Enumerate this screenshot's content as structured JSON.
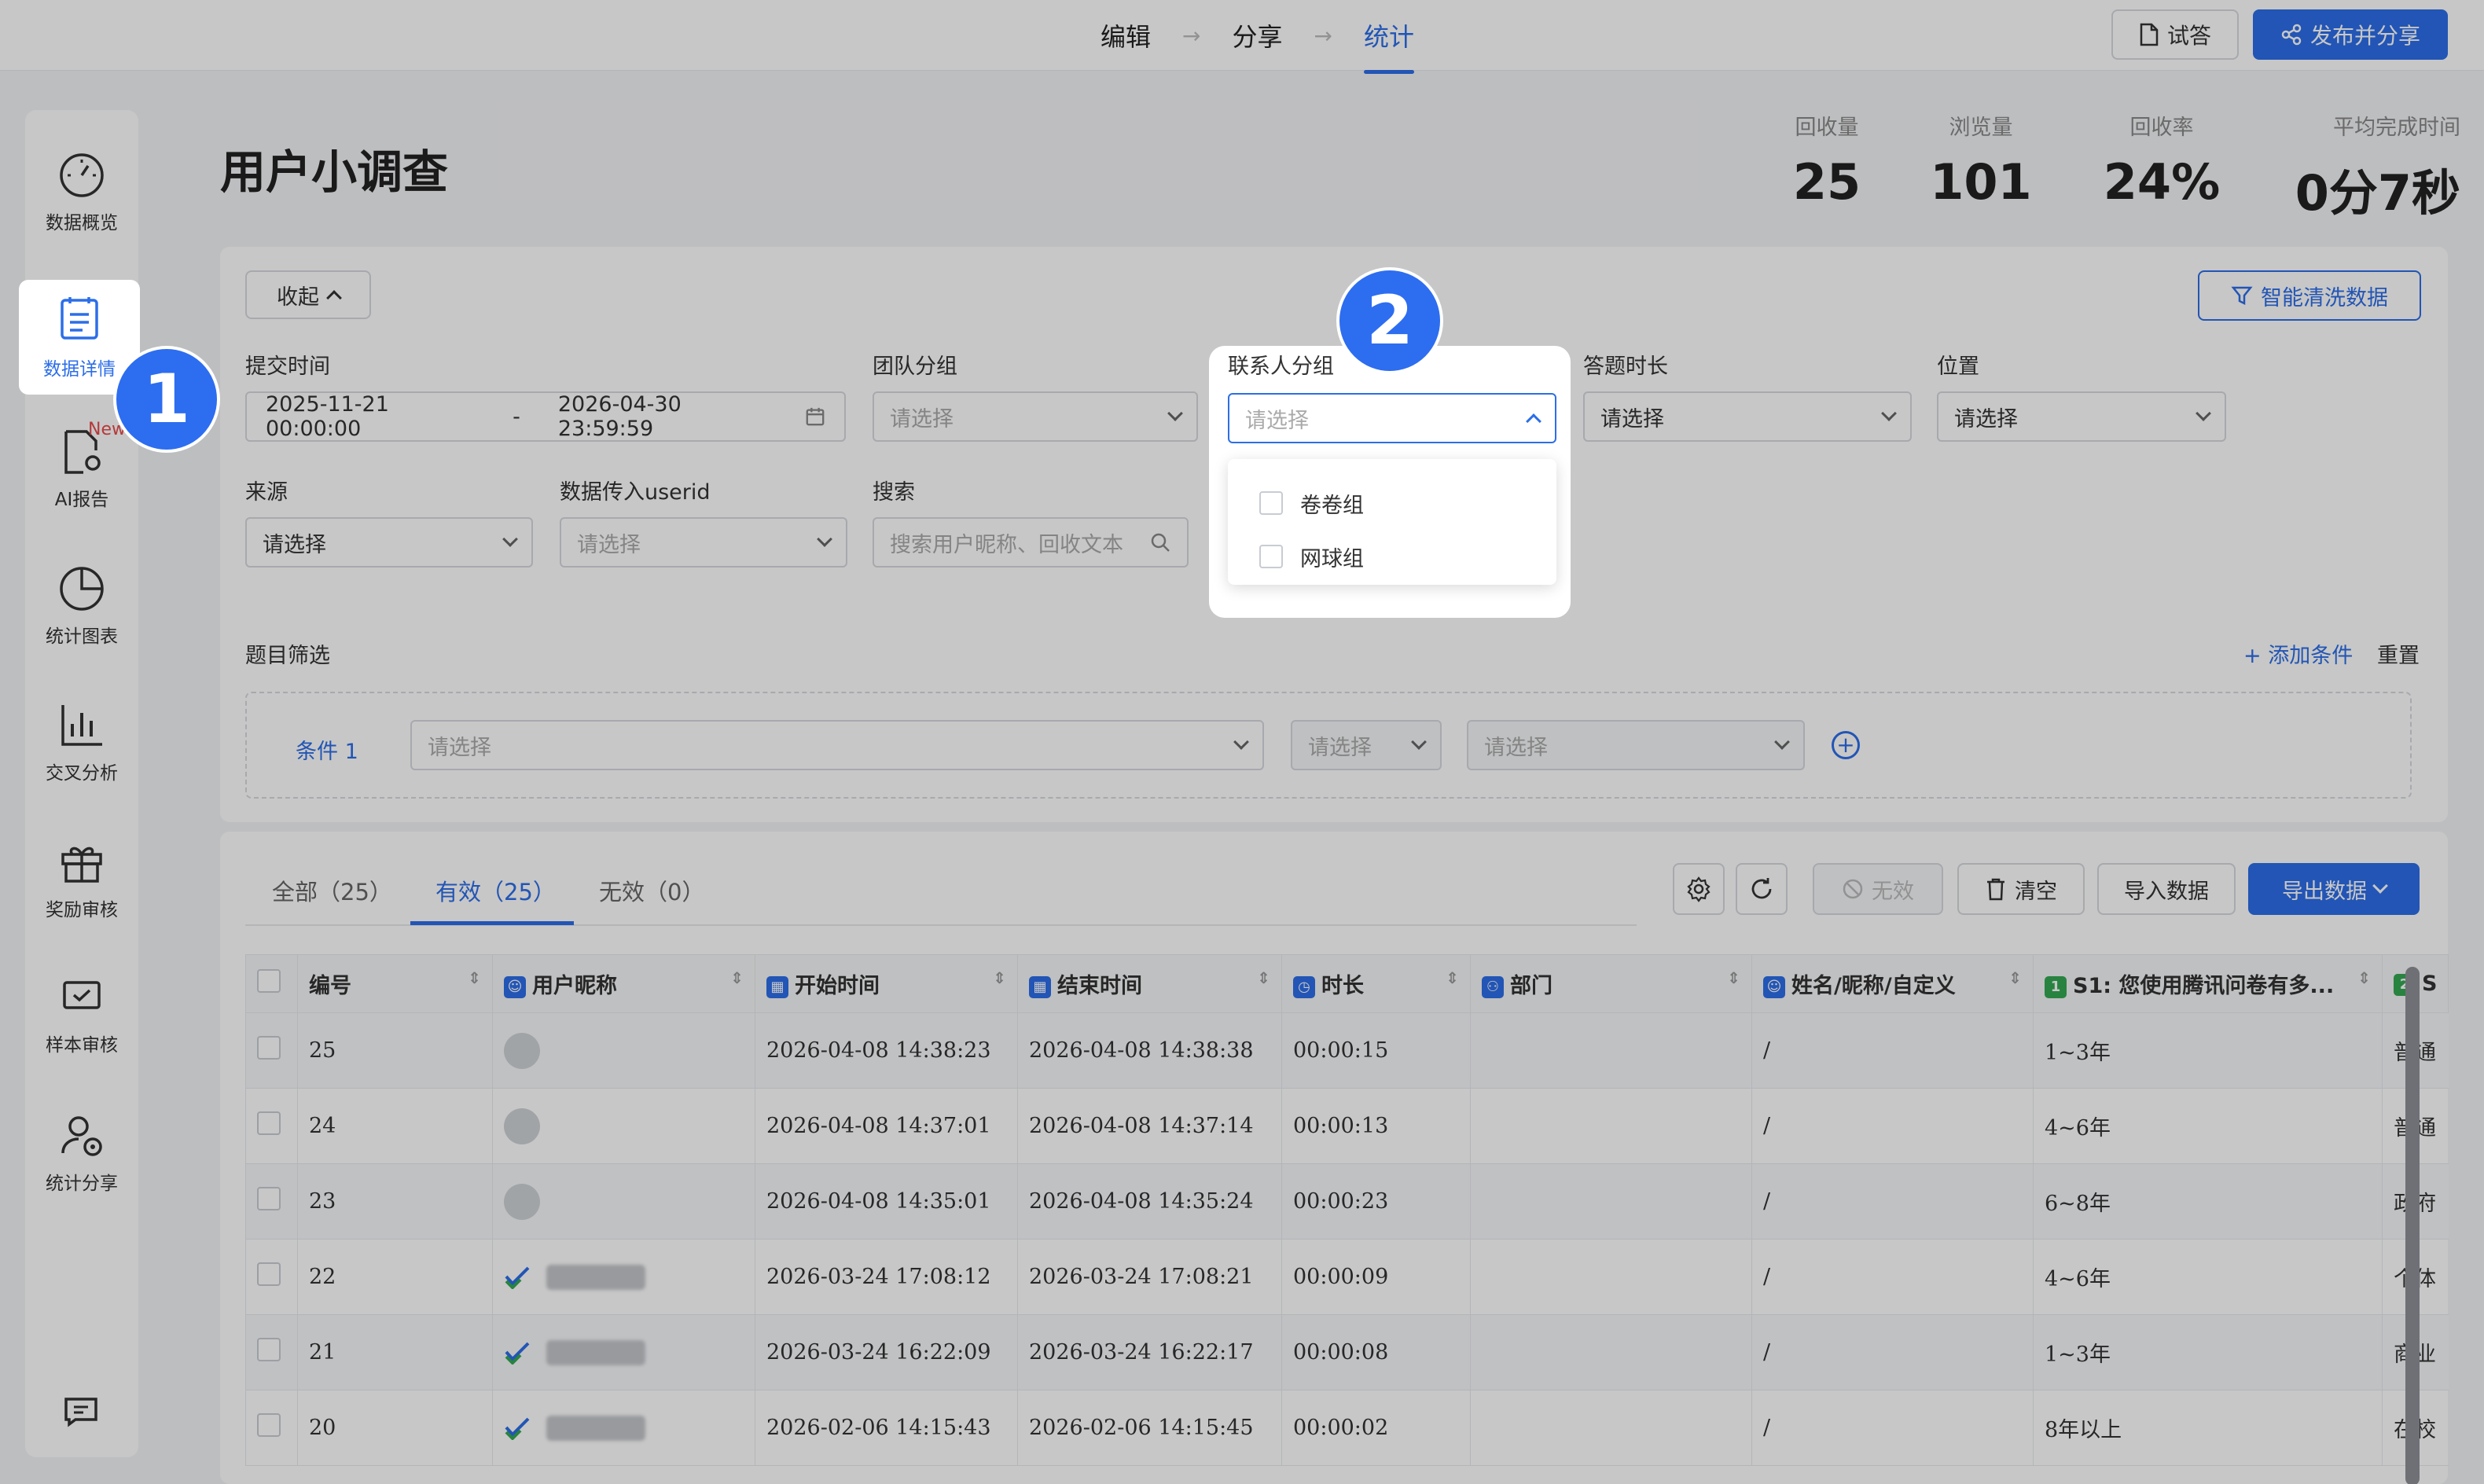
{
  "topbar": {
    "steps": [
      "编辑",
      "分享",
      "统计"
    ],
    "preview_label": "试答",
    "publish_label": "发布并分享"
  },
  "sidebar": {
    "items": [
      {
        "label": "数据概览",
        "icon": "gauge-icon"
      },
      {
        "label": "数据详情",
        "icon": "document-list-icon"
      },
      {
        "label": "AI报告",
        "icon": "ai-report-icon",
        "badge": "New"
      },
      {
        "label": "统计图表",
        "icon": "pie-chart-icon"
      },
      {
        "label": "交叉分析",
        "icon": "bar-chart-icon"
      },
      {
        "label": "奖励审核",
        "icon": "gift-icon"
      },
      {
        "label": "样本审核",
        "icon": "check-screen-icon"
      },
      {
        "label": "统计分享",
        "icon": "user-share-icon"
      }
    ]
  },
  "header": {
    "title": "用户小调查",
    "stats": [
      {
        "label": "回收量",
        "value": "25"
      },
      {
        "label": "浏览量",
        "value": "101"
      },
      {
        "label": "回收率",
        "value": "24%"
      },
      {
        "label": "平均完成时间",
        "value": "0分7秒"
      }
    ]
  },
  "filters": {
    "collapse_label": "收起",
    "smart_clean_label": "智能清洗数据",
    "submit_time": {
      "label": "提交时间",
      "start": "2025-11-21 00:00:00",
      "sep": "-",
      "end": "2026-04-30 23:59:59"
    },
    "team_group": {
      "label": "团队分组",
      "placeholder": "请选择"
    },
    "contact_group": {
      "label": "联系人分组",
      "placeholder": "请选择",
      "options": [
        "卷卷组",
        "网球组"
      ]
    },
    "answer_duration": {
      "label": "答题时长",
      "value": "请选择"
    },
    "location": {
      "label": "位置",
      "value": "请选择"
    },
    "source": {
      "label": "来源",
      "value": "请选择"
    },
    "userid": {
      "label": "数据传入userid",
      "placeholder": "请选择"
    },
    "search": {
      "label": "搜索",
      "placeholder": "搜索用户昵称、回收文本"
    },
    "question_filter_label": "题目筛选",
    "add_condition": "+ 添加条件",
    "reset": "重置",
    "condition": {
      "label": "条件 1",
      "q_placeholder": "请选择",
      "op_placeholder": "请选择",
      "val_placeholder": "请选择"
    }
  },
  "annotations": {
    "one": "1",
    "two": "2"
  },
  "table": {
    "tabs": [
      "全部（25）",
      "有效（25）",
      "无效（0）"
    ],
    "buttons": {
      "invalid": "无效",
      "clear": "清空",
      "import": "导入数据",
      "export": "导出数据"
    },
    "columns": [
      "编号",
      "用户昵称",
      "开始时间",
      "结束时间",
      "时长",
      "部门",
      "姓名/昵称/自定义",
      "S1: 您使用腾讯问卷有多...",
      "S"
    ],
    "rows": [
      {
        "id": "25",
        "start": "2026-04-08 14:38:23",
        "end": "2026-04-08 14:38:38",
        "dur": "00:00:15",
        "name": "/",
        "s1": "1~3年",
        "s2": "普通"
      },
      {
        "id": "24",
        "start": "2026-04-08 14:37:01",
        "end": "2026-04-08 14:37:14",
        "dur": "00:00:13",
        "name": "/",
        "s1": "4~6年",
        "s2": "普通"
      },
      {
        "id": "23",
        "start": "2026-04-08 14:35:01",
        "end": "2026-04-08 14:35:24",
        "dur": "00:00:23",
        "name": "/",
        "s1": "6~8年",
        "s2": "政府"
      },
      {
        "id": "22",
        "start": "2026-03-24 17:08:12",
        "end": "2026-03-24 17:08:21",
        "dur": "00:00:09",
        "name": "/",
        "s1": "4~6年",
        "s2": "个体"
      },
      {
        "id": "21",
        "start": "2026-03-24 16:22:09",
        "end": "2026-03-24 16:22:17",
        "dur": "00:00:08",
        "name": "/",
        "s1": "1~3年",
        "s2": "商业"
      },
      {
        "id": "20",
        "start": "2026-02-06 14:15:43",
        "end": "2026-02-06 14:15:45",
        "dur": "00:00:02",
        "name": "/",
        "s1": "8年以上",
        "s2": "在校"
      }
    ]
  }
}
